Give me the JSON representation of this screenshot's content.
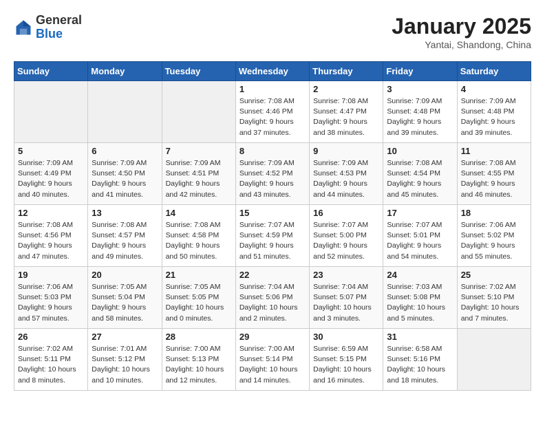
{
  "header": {
    "logo": {
      "general": "General",
      "blue": "Blue"
    },
    "title": "January 2025",
    "location": "Yantai, Shandong, China"
  },
  "days_of_week": [
    "Sunday",
    "Monday",
    "Tuesday",
    "Wednesday",
    "Thursday",
    "Friday",
    "Saturday"
  ],
  "weeks": [
    [
      {
        "day": "",
        "info": ""
      },
      {
        "day": "",
        "info": ""
      },
      {
        "day": "",
        "info": ""
      },
      {
        "day": "1",
        "info": "Sunrise: 7:08 AM\nSunset: 4:46 PM\nDaylight: 9 hours and 37 minutes."
      },
      {
        "day": "2",
        "info": "Sunrise: 7:08 AM\nSunset: 4:47 PM\nDaylight: 9 hours and 38 minutes."
      },
      {
        "day": "3",
        "info": "Sunrise: 7:09 AM\nSunset: 4:48 PM\nDaylight: 9 hours and 39 minutes."
      },
      {
        "day": "4",
        "info": "Sunrise: 7:09 AM\nSunset: 4:48 PM\nDaylight: 9 hours and 39 minutes."
      }
    ],
    [
      {
        "day": "5",
        "info": "Sunrise: 7:09 AM\nSunset: 4:49 PM\nDaylight: 9 hours and 40 minutes."
      },
      {
        "day": "6",
        "info": "Sunrise: 7:09 AM\nSunset: 4:50 PM\nDaylight: 9 hours and 41 minutes."
      },
      {
        "day": "7",
        "info": "Sunrise: 7:09 AM\nSunset: 4:51 PM\nDaylight: 9 hours and 42 minutes."
      },
      {
        "day": "8",
        "info": "Sunrise: 7:09 AM\nSunset: 4:52 PM\nDaylight: 9 hours and 43 minutes."
      },
      {
        "day": "9",
        "info": "Sunrise: 7:09 AM\nSunset: 4:53 PM\nDaylight: 9 hours and 44 minutes."
      },
      {
        "day": "10",
        "info": "Sunrise: 7:08 AM\nSunset: 4:54 PM\nDaylight: 9 hours and 45 minutes."
      },
      {
        "day": "11",
        "info": "Sunrise: 7:08 AM\nSunset: 4:55 PM\nDaylight: 9 hours and 46 minutes."
      }
    ],
    [
      {
        "day": "12",
        "info": "Sunrise: 7:08 AM\nSunset: 4:56 PM\nDaylight: 9 hours and 47 minutes."
      },
      {
        "day": "13",
        "info": "Sunrise: 7:08 AM\nSunset: 4:57 PM\nDaylight: 9 hours and 49 minutes."
      },
      {
        "day": "14",
        "info": "Sunrise: 7:08 AM\nSunset: 4:58 PM\nDaylight: 9 hours and 50 minutes."
      },
      {
        "day": "15",
        "info": "Sunrise: 7:07 AM\nSunset: 4:59 PM\nDaylight: 9 hours and 51 minutes."
      },
      {
        "day": "16",
        "info": "Sunrise: 7:07 AM\nSunset: 5:00 PM\nDaylight: 9 hours and 52 minutes."
      },
      {
        "day": "17",
        "info": "Sunrise: 7:07 AM\nSunset: 5:01 PM\nDaylight: 9 hours and 54 minutes."
      },
      {
        "day": "18",
        "info": "Sunrise: 7:06 AM\nSunset: 5:02 PM\nDaylight: 9 hours and 55 minutes."
      }
    ],
    [
      {
        "day": "19",
        "info": "Sunrise: 7:06 AM\nSunset: 5:03 PM\nDaylight: 9 hours and 57 minutes."
      },
      {
        "day": "20",
        "info": "Sunrise: 7:05 AM\nSunset: 5:04 PM\nDaylight: 9 hours and 58 minutes."
      },
      {
        "day": "21",
        "info": "Sunrise: 7:05 AM\nSunset: 5:05 PM\nDaylight: 10 hours and 0 minutes."
      },
      {
        "day": "22",
        "info": "Sunrise: 7:04 AM\nSunset: 5:06 PM\nDaylight: 10 hours and 2 minutes."
      },
      {
        "day": "23",
        "info": "Sunrise: 7:04 AM\nSunset: 5:07 PM\nDaylight: 10 hours and 3 minutes."
      },
      {
        "day": "24",
        "info": "Sunrise: 7:03 AM\nSunset: 5:08 PM\nDaylight: 10 hours and 5 minutes."
      },
      {
        "day": "25",
        "info": "Sunrise: 7:02 AM\nSunset: 5:10 PM\nDaylight: 10 hours and 7 minutes."
      }
    ],
    [
      {
        "day": "26",
        "info": "Sunrise: 7:02 AM\nSunset: 5:11 PM\nDaylight: 10 hours and 8 minutes."
      },
      {
        "day": "27",
        "info": "Sunrise: 7:01 AM\nSunset: 5:12 PM\nDaylight: 10 hours and 10 minutes."
      },
      {
        "day": "28",
        "info": "Sunrise: 7:00 AM\nSunset: 5:13 PM\nDaylight: 10 hours and 12 minutes."
      },
      {
        "day": "29",
        "info": "Sunrise: 7:00 AM\nSunset: 5:14 PM\nDaylight: 10 hours and 14 minutes."
      },
      {
        "day": "30",
        "info": "Sunrise: 6:59 AM\nSunset: 5:15 PM\nDaylight: 10 hours and 16 minutes."
      },
      {
        "day": "31",
        "info": "Sunrise: 6:58 AM\nSunset: 5:16 PM\nDaylight: 10 hours and 18 minutes."
      },
      {
        "day": "",
        "info": ""
      }
    ]
  ]
}
